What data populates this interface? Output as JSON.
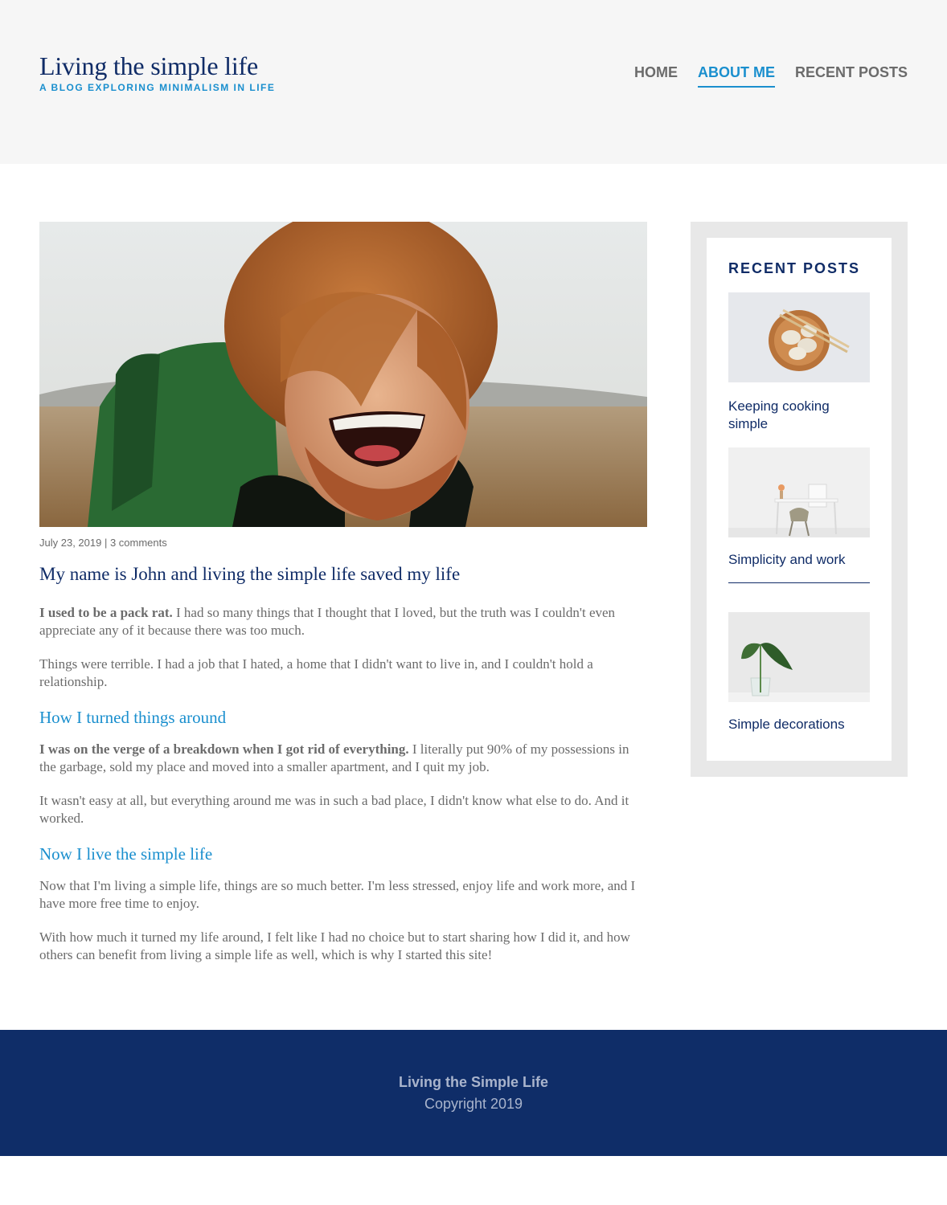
{
  "header": {
    "title": "Living the simple life",
    "subtitle": "A BLOG EXPLORING MINIMALISM IN LIFE",
    "nav": [
      {
        "label": "HOME",
        "active": false
      },
      {
        "label": "ABOUT ME",
        "active": true
      },
      {
        "label": "RECENT POSTS",
        "active": false
      }
    ]
  },
  "post": {
    "hero_image": "smiling man with red hair wearing green backpack outdoors",
    "date": "July 23, 2019",
    "separator": " | ",
    "comments": "3 comments",
    "title": "My name is John and living the simple life saved my life",
    "p1_bold": "I used to be a pack rat.",
    "p1_rest": " I had so many things that I thought that I loved, but the truth was I couldn't even appreciate any of it because there was too much.",
    "p2": "Things were terrible. I had a job that I hated, a home that I didn't want to live in, and I couldn't hold a relationship.",
    "h2_1": "How I turned things around",
    "p3_bold": "I was on the verge of a breakdown when I got rid of everything.",
    "p3_rest": " I literally put 90% of my possessions in the garbage, sold my place and moved into a smaller apartment, and I quit my job.",
    "p4": "It wasn't easy at all, but everything around me was in such a bad place, I didn't know what else to do. And it worked.",
    "h2_2": "Now I live the simple life",
    "p5": "Now that I'm living a simple life, things are so much better. I'm less stressed, enjoy life and work more, and I have more free time to enjoy.",
    "p6": "With how much it turned my life around, I felt like I had no choice but to start sharing how I did it, and how others can benefit from living a simple life as well, which is why I started this site!"
  },
  "sidebar": {
    "heading": "RECENT POSTS",
    "items": [
      {
        "label": "Keeping cooking simple",
        "image": "wooden bowl of dumplings with chopsticks"
      },
      {
        "label": "Simplicity and work",
        "image": "minimal desk with chair against white wall"
      },
      {
        "label": "Simple decorations",
        "image": "plant leaf in glass vase"
      }
    ]
  },
  "footer": {
    "title": "Living the Simple Life",
    "copyright": "Copyright 2019"
  },
  "colors": {
    "navy": "#102c67",
    "accent_blue": "#1a8fce",
    "text_gray": "#6b6b6b",
    "header_bg": "#f6f6f6",
    "footer_bg": "#0f2d68"
  }
}
